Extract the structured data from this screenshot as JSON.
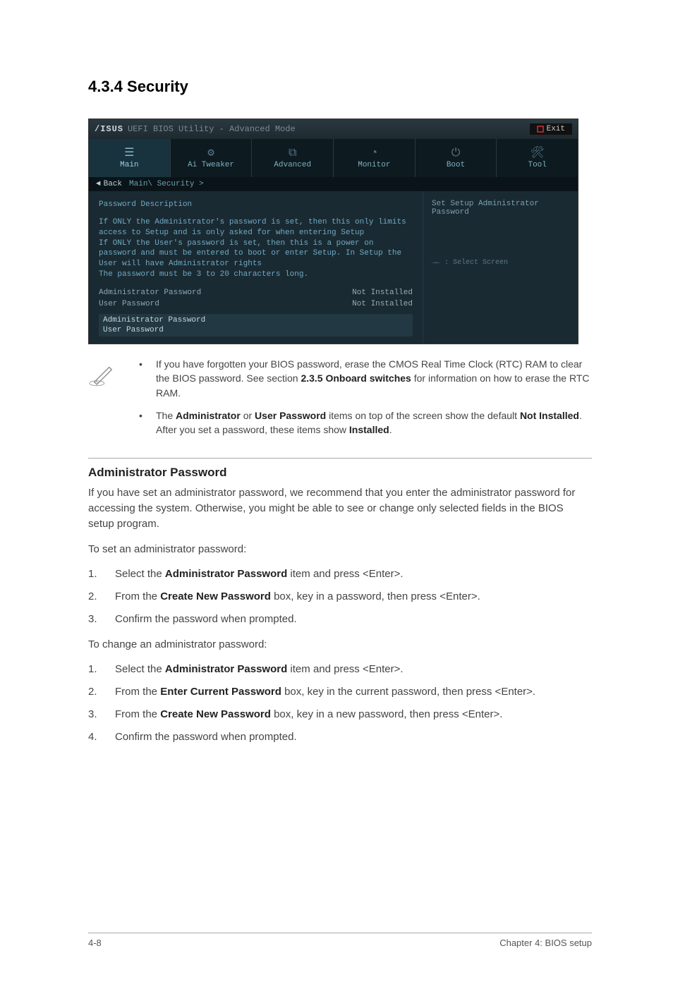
{
  "heading": "4.3.4    Security",
  "bios": {
    "brand": "/ISUS",
    "mode": "UEFI BIOS Utility - Advanced Mode",
    "exit": "Exit",
    "tabs": {
      "main": "Main",
      "ai": "Ai Tweaker",
      "adv": "Advanced",
      "mon": "Monitor",
      "boot": "Boot",
      "tool": "Tool"
    },
    "back": "Back",
    "breadcrumb": "Main\\ Security >",
    "desc_title": "Password Description",
    "desc_body": "If ONLY the Administrator's password is set, then this only limits access to Setup and is only asked for when entering Setup\nIf ONLY the User's password is set, then this is a power on password and must be entered to boot or enter Setup. In Setup the User will have Administrator rights\nThe password must be 3 to 20 characters long.",
    "rows": {
      "admin_label": "Administrator Password",
      "admin_val": "Not Installed",
      "user_label": "User Password",
      "user_val": "Not Installed"
    },
    "sel": {
      "admin": "Administrator Password",
      "user": "User Password"
    },
    "right_help": "Set Setup Administrator Password",
    "right_foot": "→← : Select Screen"
  },
  "notes": {
    "n1a": "If you have forgotten your BIOS password, erase the CMOS Real Time Clock (RTC) RAM to clear the BIOS password. See section ",
    "n1b": "2.3.5 Onboard switches",
    "n1c": " for information on how to erase the RTC RAM.",
    "n2a": "The ",
    "n2b": "Administrator",
    "n2c": " or ",
    "n2d": "User Password",
    "n2e": " items on top of the screen show the default ",
    "n2f": "Not Installed",
    "n2g": ". After you set a password, these items show ",
    "n2h": "Installed",
    "n2i": "."
  },
  "subhead": "Administrator Password",
  "para1": "If you have set an administrator password, we recommend that you enter the administrator password for accessing the system. Otherwise, you might be able to see or change only selected fields in the BIOS setup program.",
  "para2": "To set an administrator password:",
  "set_steps": {
    "s1a": "Select the ",
    "s1b": "Administrator Password",
    "s1c": " item and press <Enter>.",
    "s2a": "From the ",
    "s2b": "Create New Password",
    "s2c": " box, key in a password, then press <Enter>.",
    "s3": "Confirm the password when prompted."
  },
  "para3": "To change an administrator password:",
  "chg_steps": {
    "c1a": "Select the ",
    "c1b": "Administrator Password",
    "c1c": " item and press <Enter>.",
    "c2a": "From the ",
    "c2b": "Enter Current Password",
    "c2c": " box, key in the current password, then press <Enter>.",
    "c3a": "From the ",
    "c3b": "Create New Password",
    "c3c": " box, key in a new password, then press <Enter>.",
    "c4": "Confirm the password when prompted."
  },
  "footer": {
    "left": "4-8",
    "right": "Chapter 4: BIOS setup"
  },
  "nums": {
    "n1": "1.",
    "n2": "2.",
    "n3": "3.",
    "n4": "4."
  },
  "bullet": "•"
}
